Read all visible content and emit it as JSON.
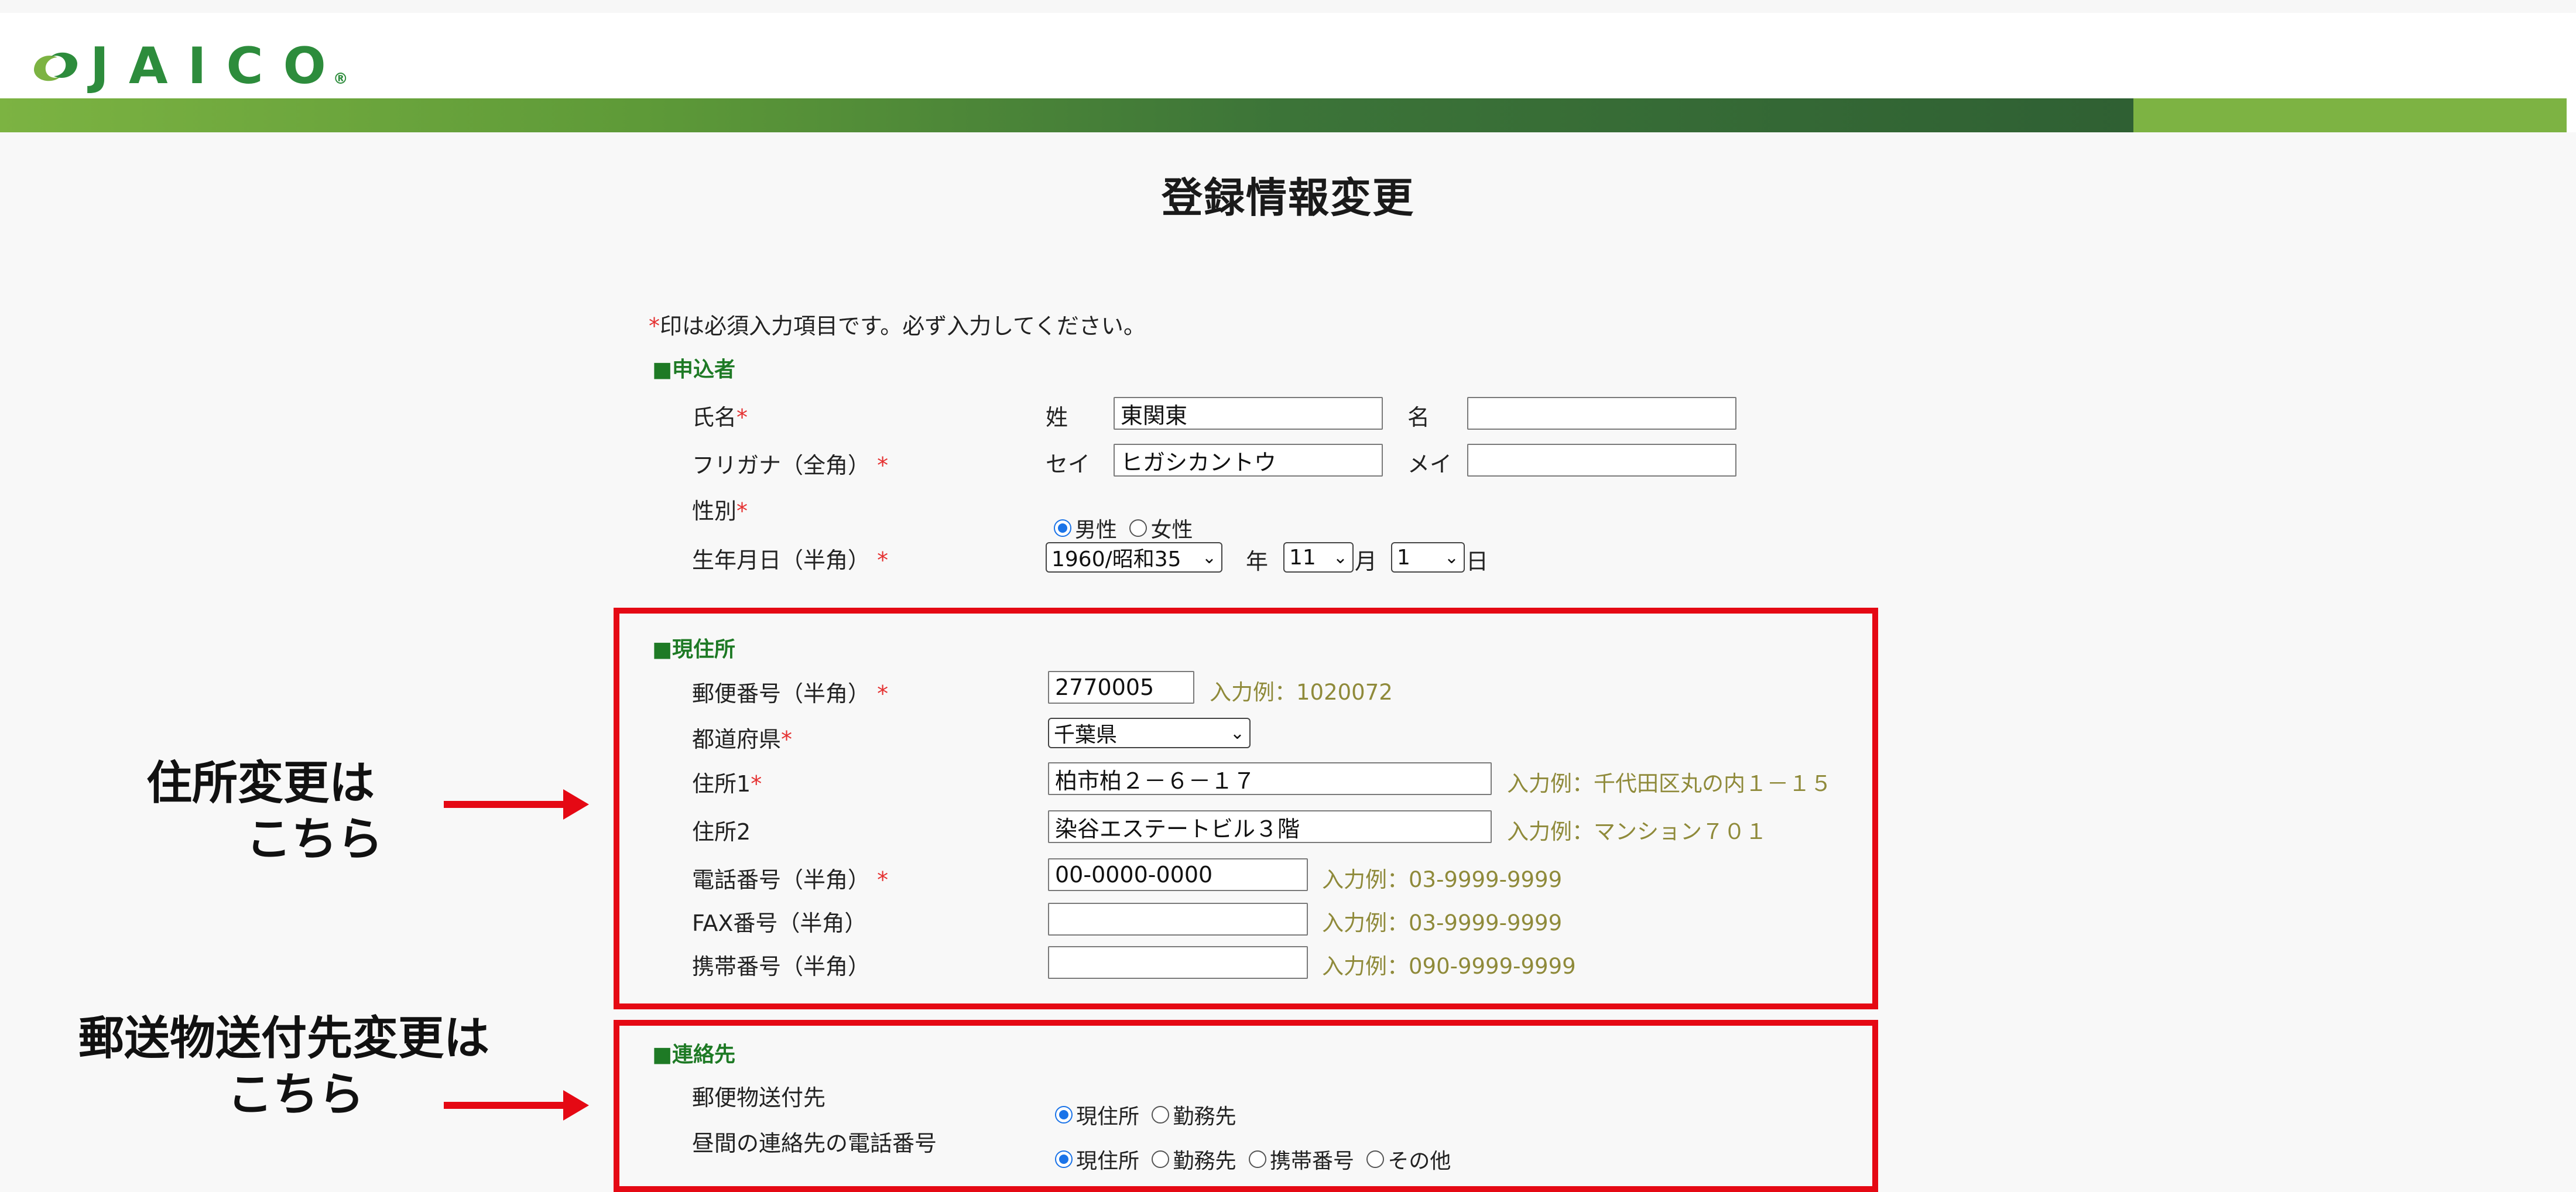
{
  "brand": {
    "logo_text": "JAICO",
    "reg_mark": "®"
  },
  "page": {
    "title": "登録情報変更"
  },
  "note": {
    "asterisk": "*",
    "text": "印は必須入力項目です。必ず入力してください。"
  },
  "applicant": {
    "heading": "■申込者",
    "name_label": "氏名",
    "sei_label": "姓",
    "sei_value": "東関東",
    "mei_label": "名",
    "mei_value": "",
    "furigana_label": "フリガナ（全角）",
    "sei_kana_label": "セイ",
    "sei_kana_value": "ヒガシカントウ",
    "mei_kana_label": "メイ",
    "mei_kana_value": "",
    "gender_label": "性別",
    "gender_male": "男性",
    "gender_female": "女性",
    "birth_label": "生年月日（半角）",
    "birth_year": "1960/昭和35",
    "year_unit": "年",
    "birth_month": "11",
    "month_unit": "月",
    "birth_day": "1",
    "day_unit": "日"
  },
  "address": {
    "heading": "■現住所",
    "zip_label": "郵便番号（半角）",
    "zip_value": "2770005",
    "zip_example": "入力例：1020072",
    "pref_label": "都道府県",
    "pref_value": "千葉県",
    "addr1_label": "住所1",
    "addr1_value": "柏市柏２－６－１７",
    "addr1_example": "入力例：千代田区丸の内１－１５",
    "addr2_label": "住所2",
    "addr2_value": "染谷エステートビル３階",
    "addr2_example": "入力例：マンション７０１",
    "tel_label": "電話番号（半角）",
    "tel_value": "00-0000-0000",
    "tel_example": "入力例：03-9999-9999",
    "fax_label": "FAX番号（半角）",
    "fax_value": "",
    "fax_example": "入力例：03-9999-9999",
    "mobile_label": "携帯番号（半角）",
    "mobile_value": "",
    "mobile_example": "入力例：090-9999-9999"
  },
  "contact": {
    "heading": "■連絡先",
    "mail_dest_label": "郵便物送付先",
    "opt_home": "現住所",
    "opt_work": "勤務先",
    "day_tel_label": "昼間の連絡先の電話番号",
    "opt_mobile": "携帯番号",
    "opt_other": "その他"
  },
  "annotations": {
    "address_change_line1": "住所変更は",
    "address_change_line2": "こちら",
    "mail_change_line1": "郵送物送付先変更は",
    "mail_change_line2": "こちら"
  },
  "colors": {
    "accent_green": "#1e7a25",
    "annotation_red": "#e50914",
    "example_text": "#8f8a3a"
  }
}
